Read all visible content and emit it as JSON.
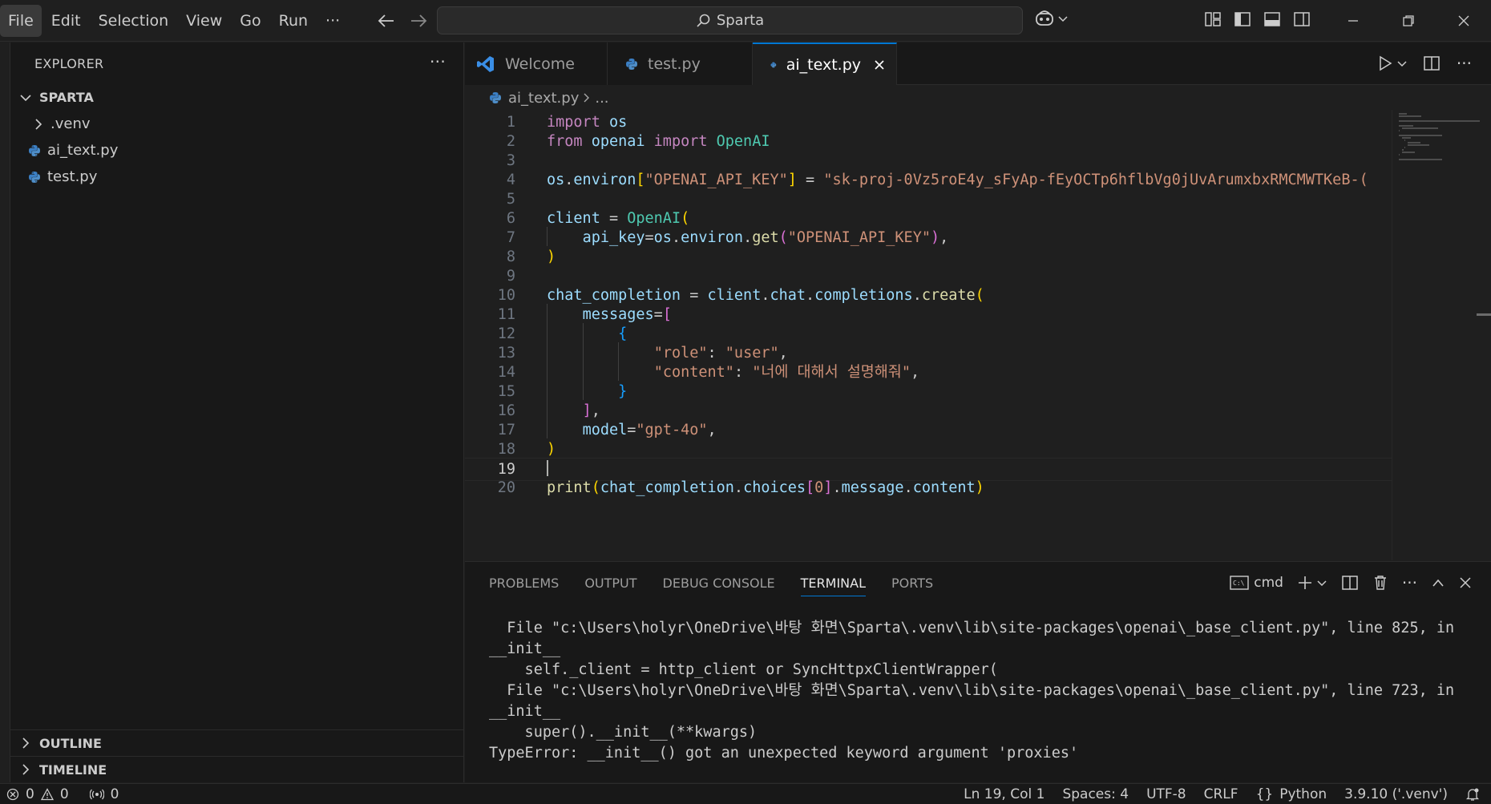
{
  "menu": [
    "File",
    "Edit",
    "Selection",
    "View",
    "Go",
    "Run",
    "···"
  ],
  "search": {
    "text": "Sparta"
  },
  "sidebar": {
    "title": "EXPLORER",
    "more": "···",
    "root": "SPARTA",
    "items": [
      {
        "label": ".venv",
        "type": "folder"
      },
      {
        "label": "ai_text.py",
        "type": "python"
      },
      {
        "label": "test.py",
        "type": "python"
      }
    ],
    "outline": "OUTLINE",
    "timeline": "TIMELINE"
  },
  "tabs": [
    {
      "label": "Welcome",
      "icon": "vscode-icon",
      "active": false
    },
    {
      "label": "test.py",
      "icon": "python-icon",
      "active": false
    },
    {
      "label": "ai_text.py",
      "icon": "python-icon",
      "active": true
    }
  ],
  "breadcrumb": {
    "file": "ai_text.py",
    "rest": "..."
  },
  "editor": {
    "current_line": 19,
    "line_numbers": [
      "1",
      "2",
      "3",
      "4",
      "5",
      "6",
      "7",
      "8",
      "9",
      "10",
      "11",
      "12",
      "13",
      "14",
      "15",
      "16",
      "17",
      "18",
      "19",
      "20"
    ],
    "lines": [
      "import os",
      "from openai import OpenAI",
      "",
      "os.environ[\"OPENAI_API_KEY\"] = \"sk-proj-0Vz5roE4y_sFyAp-fEyOCTp6hflbVg0jUvArumxbxRMCMWTKeB-(",
      "",
      "client = OpenAI(",
      "    api_key=os.environ.get(\"OPENAI_API_KEY\"),",
      ")",
      "",
      "chat_completion = client.chat.completions.create(",
      "    messages=[",
      "        {",
      "            \"role\": \"user\",",
      "            \"content\": \"너에 대해서 설명해줘\",",
      "        }",
      "    ],",
      "    model=\"gpt-4o\",",
      ")",
      "",
      "print(chat_completion.choices[0].message.content)"
    ]
  },
  "panel": {
    "tabs": [
      "PROBLEMS",
      "OUTPUT",
      "DEBUG CONSOLE",
      "TERMINAL",
      "PORTS"
    ],
    "active_tab": "TERMINAL",
    "shell": "cmd",
    "terminal_lines": [
      "  File \"c:\\Users\\holyr\\OneDrive\\바탕 화면\\Sparta\\.venv\\lib\\site-packages\\openai\\_base_client.py\", line 825, in",
      "__init__",
      "    self._client = http_client or SyncHttpxClientWrapper(",
      "  File \"c:\\Users\\holyr\\OneDrive\\바탕 화면\\Sparta\\.venv\\lib\\site-packages\\openai\\_base_client.py\", line 723, in",
      "__init__",
      "    super().__init__(**kwargs)",
      "TypeError: __init__() got an unexpected keyword argument 'proxies'"
    ]
  },
  "status": {
    "errors": "0",
    "warnings": "0",
    "ports": "0",
    "position": "Ln 19, Col 1",
    "spaces": "Spaces: 4",
    "encoding": "UTF-8",
    "eol": "CRLF",
    "language_icon": "{}",
    "language": "Python",
    "interpreter": "3.9.10 ('.venv')"
  },
  "colors": {
    "accent": "#0078d4",
    "background": "#1f1f1f",
    "sidebar": "#181818",
    "keyword": "#c586c0",
    "string": "#ce9178",
    "variable": "#9cdcfe",
    "function": "#dcdcaa",
    "class": "#4ec9b0"
  }
}
